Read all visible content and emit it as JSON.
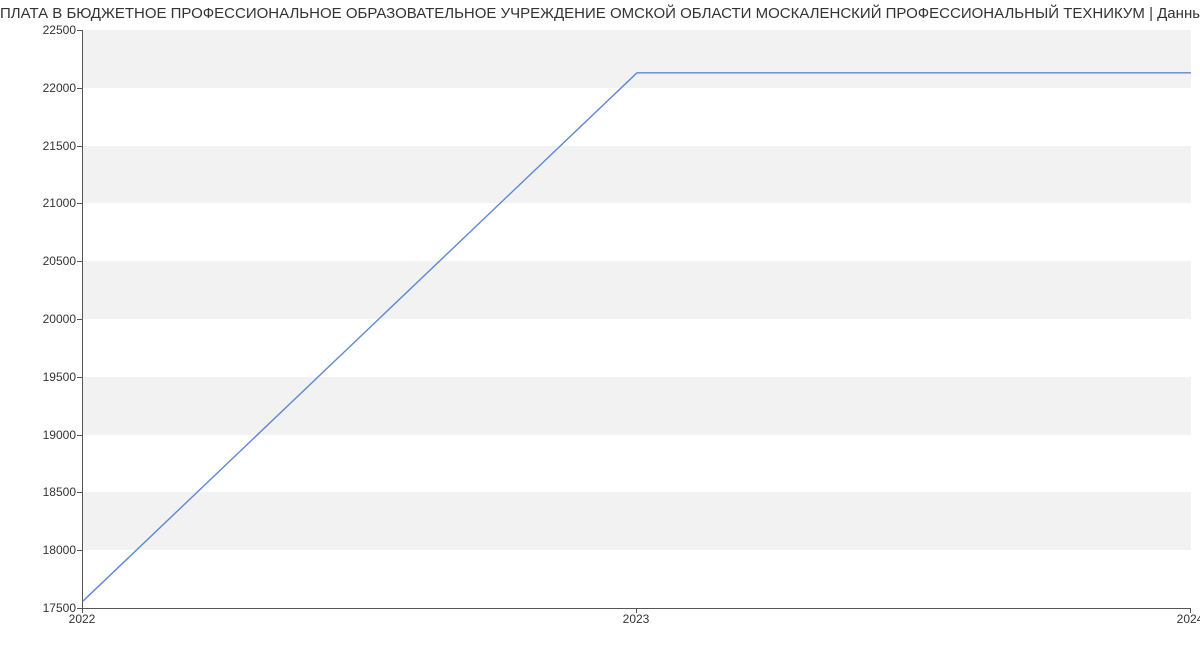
{
  "chart_data": {
    "type": "line",
    "title": "ПЛАТА В БЮДЖЕТНОЕ ПРОФЕССИОНАЛЬНОЕ ОБРАЗОВАТЕЛЬНОЕ УЧРЕЖДЕНИЕ ОМСКОЙ ОБЛАСТИ МОСКАЛЕНСКИЙ ПРОФЕССИОНАЛЬНЫЙ ТЕХНИКУМ | Данные mnogo.w",
    "x": [
      2022,
      2023,
      2024
    ],
    "values": [
      17560,
      22130,
      22130
    ],
    "xlabel": "",
    "ylabel": "",
    "yticks": [
      17500,
      18000,
      18500,
      19000,
      19500,
      20000,
      20500,
      21000,
      21500,
      22000,
      22500
    ],
    "xticks": [
      2022,
      2023,
      2024
    ],
    "xlim": [
      2022,
      2024
    ],
    "ylim": [
      17500,
      22500
    ],
    "line_color": "#5b88d6",
    "band_color": "#f2f2f2"
  }
}
